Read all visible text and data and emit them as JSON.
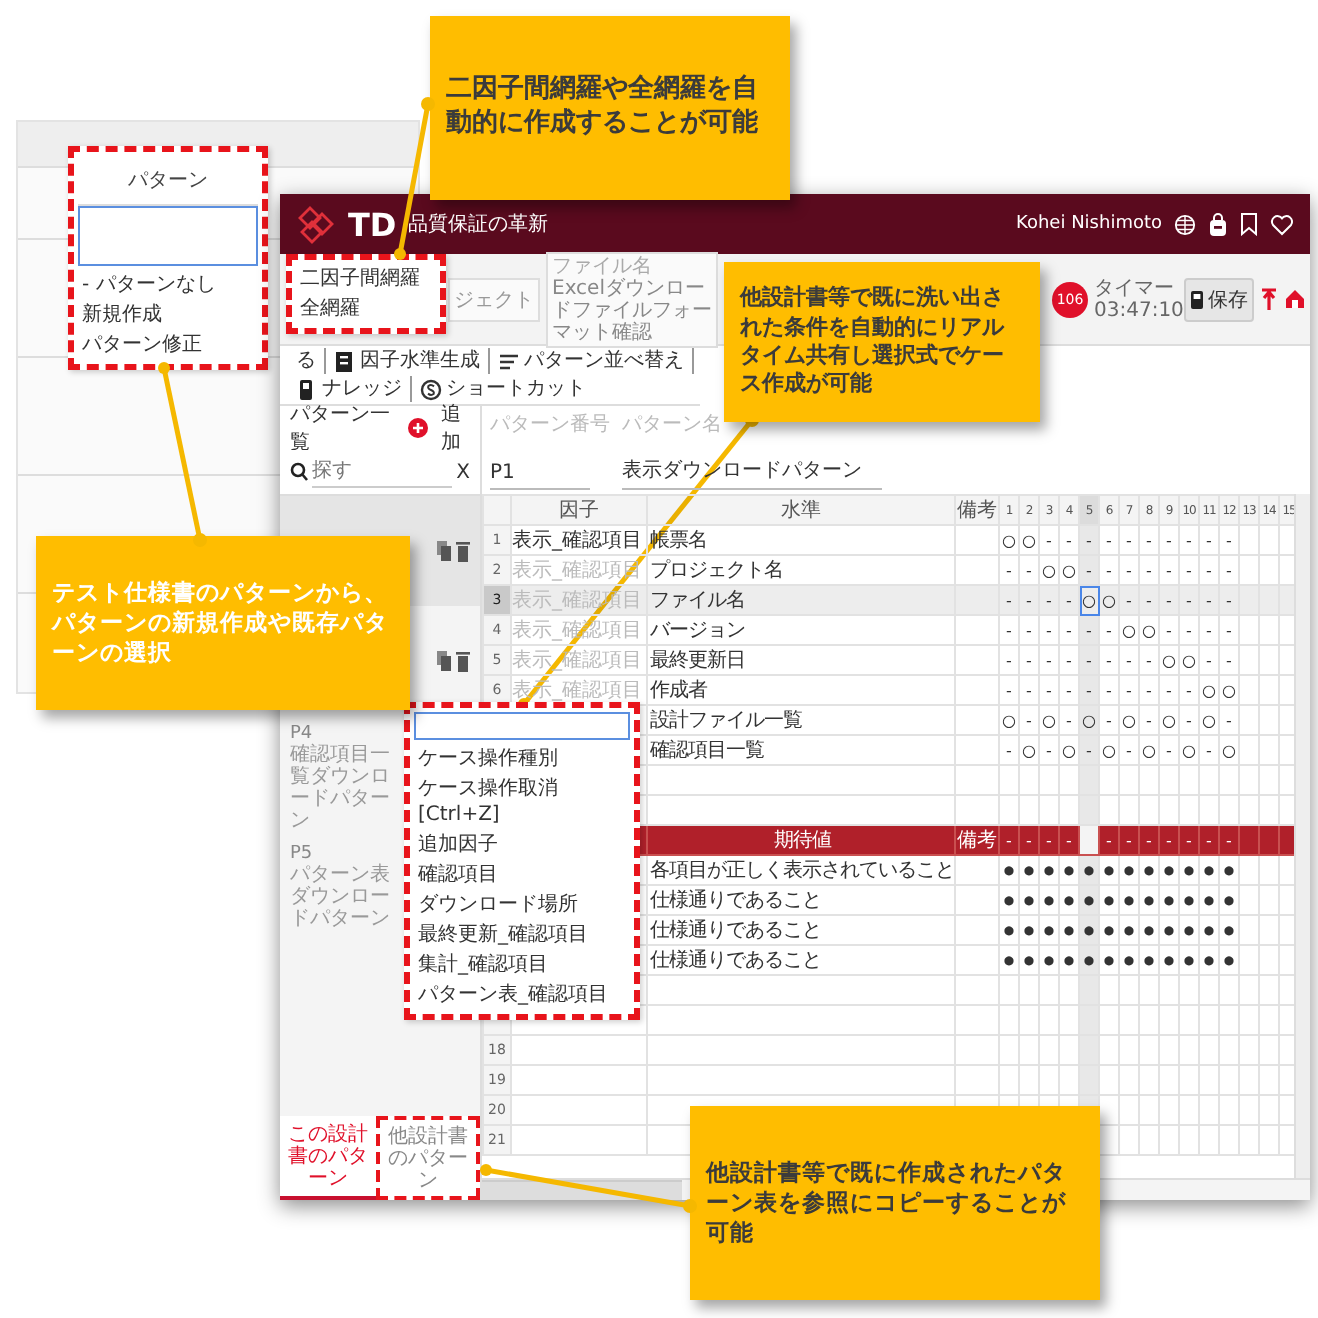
{
  "background_screen": {
    "column_header": "パターン",
    "dropdown": {
      "options": [
        "- パターンなし",
        "新規作成",
        "パターン修正"
      ]
    }
  },
  "window": {
    "logo": "TD",
    "app_name": "品質保証の革新",
    "user": "Kohei Nishimoto"
  },
  "toolbar": {
    "field_1": {
      "value": "ジェクト"
    },
    "file_field": {
      "label": "ファイル名",
      "value": "Excelダウンロードファイルフォーマット確認"
    },
    "badge": "106",
    "timer": "タイマー 03:47:10",
    "save_button": "保存"
  },
  "mode_menu": {
    "options": [
      "二因子間網羅",
      "全網羅"
    ]
  },
  "actions": [
    {
      "kind": "text",
      "label": "る"
    },
    {
      "kind": "grid",
      "label": "因子水準生成"
    },
    {
      "kind": "sort",
      "label": "パターン並べ替え"
    },
    {
      "kind": "book",
      "label": "ナレッジ"
    },
    {
      "kind": "shortcut",
      "label": "ショートカット"
    }
  ],
  "pattern_list": {
    "title": "パターン一覧",
    "add_button": "追加",
    "search": {
      "placeholder": "探す"
    },
    "clear_button": "X",
    "items": [
      {
        "selected": true,
        "show_actions": true
      },
      {
        "selected": false,
        "show_actions": true
      },
      {
        "number": "P4",
        "name": "確認項目一覧ダウンロードパターン",
        "selected": false
      },
      {
        "number": "P5",
        "name": "パターン表ダウンロードパターン",
        "selected": false
      }
    ]
  },
  "tabs": [
    {
      "label": "この設計書のパターン",
      "selected": true
    },
    {
      "label": "他設計書のパターン",
      "selected": false
    }
  ],
  "pattern": {
    "number_label": "パターン番号",
    "number": "P1",
    "name_label": "パターン名",
    "name": "表示ダウンロードパターン"
  },
  "table": {
    "columns": [
      "因子",
      "水準",
      "備考"
    ],
    "case_columns": [
      {
        "label": "1",
        "selected": false
      },
      {
        "label": "2",
        "selected": false
      },
      {
        "label": "3",
        "selected": false
      },
      {
        "label": "4",
        "selected": false
      },
      {
        "label": "5",
        "selected": true
      },
      {
        "label": "6",
        "selected": false
      },
      {
        "label": "7",
        "selected": false
      },
      {
        "label": "8",
        "selected": false
      },
      {
        "label": "9",
        "selected": false
      },
      {
        "label": "10",
        "selected": false
      },
      {
        "label": "11",
        "selected": false
      },
      {
        "label": "12",
        "selected": false
      },
      {
        "label": "13",
        "selected": false
      },
      {
        "label": "14",
        "selected": false
      },
      {
        "label": "15",
        "selected": false
      }
    ],
    "rows": [
      {
        "kind": "data",
        "number": "1",
        "factor": "表示_確認項目",
        "dimmed": false,
        "level": "帳票名",
        "selected": false,
        "cells": [
          "○",
          "○",
          "-",
          "-",
          "-",
          "-",
          "-",
          "-",
          "-",
          "-",
          "-",
          "-"
        ]
      },
      {
        "kind": "data",
        "number": "2",
        "factor": "表示_確認項目",
        "dimmed": true,
        "level": "プロジェクト名",
        "selected": false,
        "cells": [
          "-",
          "-",
          "○",
          "○",
          "-",
          "-",
          "-",
          "-",
          "-",
          "-",
          "-",
          "-"
        ]
      },
      {
        "kind": "data",
        "number": "3",
        "factor": "表示_確認項目",
        "dimmed": true,
        "level": "ファイル名",
        "selected": true,
        "cells": [
          "-",
          "-",
          "-",
          "-",
          "○",
          "○",
          "-",
          "-",
          "-",
          "-",
          "-",
          "-"
        ]
      },
      {
        "kind": "data",
        "number": "4",
        "factor": "表示_確認項目",
        "dimmed": true,
        "level": "バージョン",
        "selected": false,
        "cells": [
          "-",
          "-",
          "-",
          "-",
          "-",
          "-",
          "○",
          "○",
          "-",
          "-",
          "-",
          "-"
        ]
      },
      {
        "kind": "data",
        "number": "5",
        "factor": "表示_確認項目",
        "dimmed": true,
        "level": "最終更新日",
        "selected": false,
        "cells": [
          "-",
          "-",
          "-",
          "-",
          "-",
          "-",
          "-",
          "-",
          "○",
          "○",
          "-",
          "-"
        ]
      },
      {
        "kind": "data",
        "number": "6",
        "factor": "表示_確認項目",
        "dimmed": true,
        "level": "作成者",
        "selected": false,
        "cells": [
          "-",
          "-",
          "-",
          "-",
          "-",
          "-",
          "-",
          "-",
          "-",
          "-",
          "○",
          "○"
        ]
      },
      {
        "kind": "data",
        "level": "設計ファイル一覧",
        "selected": false,
        "cells": [
          "○",
          "-",
          "○",
          "-",
          "○",
          "-",
          "○",
          "-",
          "○",
          "-",
          "○",
          "-"
        ]
      },
      {
        "kind": "data",
        "level": "確認項目一覧",
        "selected": false,
        "cells": [
          "-",
          "○",
          "-",
          "○",
          "-",
          "○",
          "-",
          "○",
          "-",
          "○",
          "-",
          "○"
        ]
      },
      {
        "kind": "data",
        "selected": false
      },
      {
        "kind": "data",
        "selected": false
      },
      {
        "kind": "section",
        "level": "期待値",
        "note": "備考",
        "selected": false,
        "cells": [
          "-",
          "-",
          "-",
          "-",
          null,
          "-",
          "-",
          "-",
          "-",
          "-",
          "-",
          "-"
        ]
      },
      {
        "kind": "data",
        "level": "各項目が正しく表示されていること",
        "selected": false,
        "cells": [
          "●",
          "●",
          "●",
          "●",
          "●",
          "●",
          "●",
          "●",
          "●",
          "●",
          "●",
          "●"
        ]
      },
      {
        "kind": "data",
        "level": "仕様通りであること",
        "selected": false,
        "cells": [
          "●",
          "●",
          "●",
          "●",
          "●",
          "●",
          "●",
          "●",
          "●",
          "●",
          "●",
          "●"
        ]
      },
      {
        "kind": "data",
        "level": "仕様通りであること",
        "selected": false,
        "cells": [
          "●",
          "●",
          "●",
          "●",
          "●",
          "●",
          "●",
          "●",
          "●",
          "●",
          "●",
          "●"
        ]
      },
      {
        "kind": "data",
        "level": "仕様通りであること",
        "selected": false,
        "cells": [
          "●",
          "●",
          "●",
          "●",
          "●",
          "●",
          "●",
          "●",
          "●",
          "●",
          "●",
          "●"
        ]
      },
      {
        "kind": "data",
        "selected": false
      },
      {
        "kind": "data",
        "selected": false
      },
      {
        "kind": "data",
        "number": "18",
        "selected": false
      },
      {
        "kind": "data",
        "number": "19",
        "selected": false
      },
      {
        "kind": "data",
        "number": "20",
        "selected": false
      },
      {
        "kind": "data",
        "number": "21",
        "selected": false
      }
    ]
  },
  "table_menu": {
    "options": [
      "ケース操作種別",
      "ケース操作取消 [Ctrl+Z]",
      "追加因子",
      "確認項目",
      "ダウンロード場所",
      "最終更新_確認項目",
      "集計_確認項目",
      "パターン表_確認項目"
    ]
  },
  "callouts": [
    {
      "kind": "dark_text",
      "text": "二因子間網羅や全網羅を自動的に作成することが可能"
    },
    {
      "kind": "dark_text",
      "text": "他設計書等で既に洗い出された条件を自動的にリアルタイム共有し選択式でケース作成が可能"
    },
    {
      "kind": "white_text",
      "text": "テスト仕様書のパターンから、パターンの新規作成や既存パターンの選択"
    },
    {
      "kind": "dark_text",
      "text": "他設計書等で既に作成されたパターン表を参照にコピーすることが可能"
    }
  ]
}
